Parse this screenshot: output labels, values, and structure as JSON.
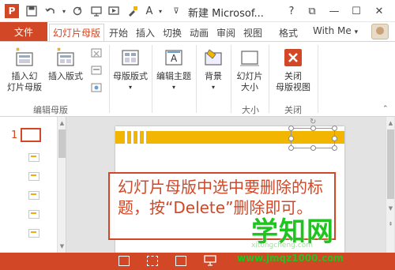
{
  "titlebar": {
    "app_glyph": "P",
    "doc_title": "新建 Microsof...",
    "font_color_button": "A",
    "help": "?",
    "restore_glyph": "⧉",
    "minimize_glyph": "—",
    "maximize_glyph": "☐",
    "close_glyph": "✕"
  },
  "tabs": {
    "file": "文件",
    "items": [
      "幻灯片母版",
      "开始",
      "插入",
      "切换",
      "动画",
      "审阅",
      "视图",
      "格式"
    ],
    "active_index": 0,
    "user": "With Me",
    "user_caret": "▾"
  },
  "ribbon": {
    "groups": {
      "edit_master": "编辑母版",
      "size": "大小",
      "close": "关闭"
    },
    "buttons": {
      "insert_master": "插入幻\n灯片母版",
      "insert_layout": "插入版式",
      "master_layout": "母版版式",
      "edit_theme": "编辑主题",
      "background": "背景",
      "slide_size": "幻灯片\n大小",
      "close_master": "关闭\n母版视图"
    }
  },
  "thumbs": {
    "slide_number": "1"
  },
  "callout": {
    "text": "幻灯片母版中选中要删除的标题，按“Delete”删除即可。"
  },
  "watermark": {
    "title": "学知网",
    "site": "xitongcheng.com",
    "url": "www.jmqz1000.com"
  },
  "colors": {
    "accent": "#d24726",
    "stripe": "#f2b600",
    "watermark": "#1fc51f"
  }
}
